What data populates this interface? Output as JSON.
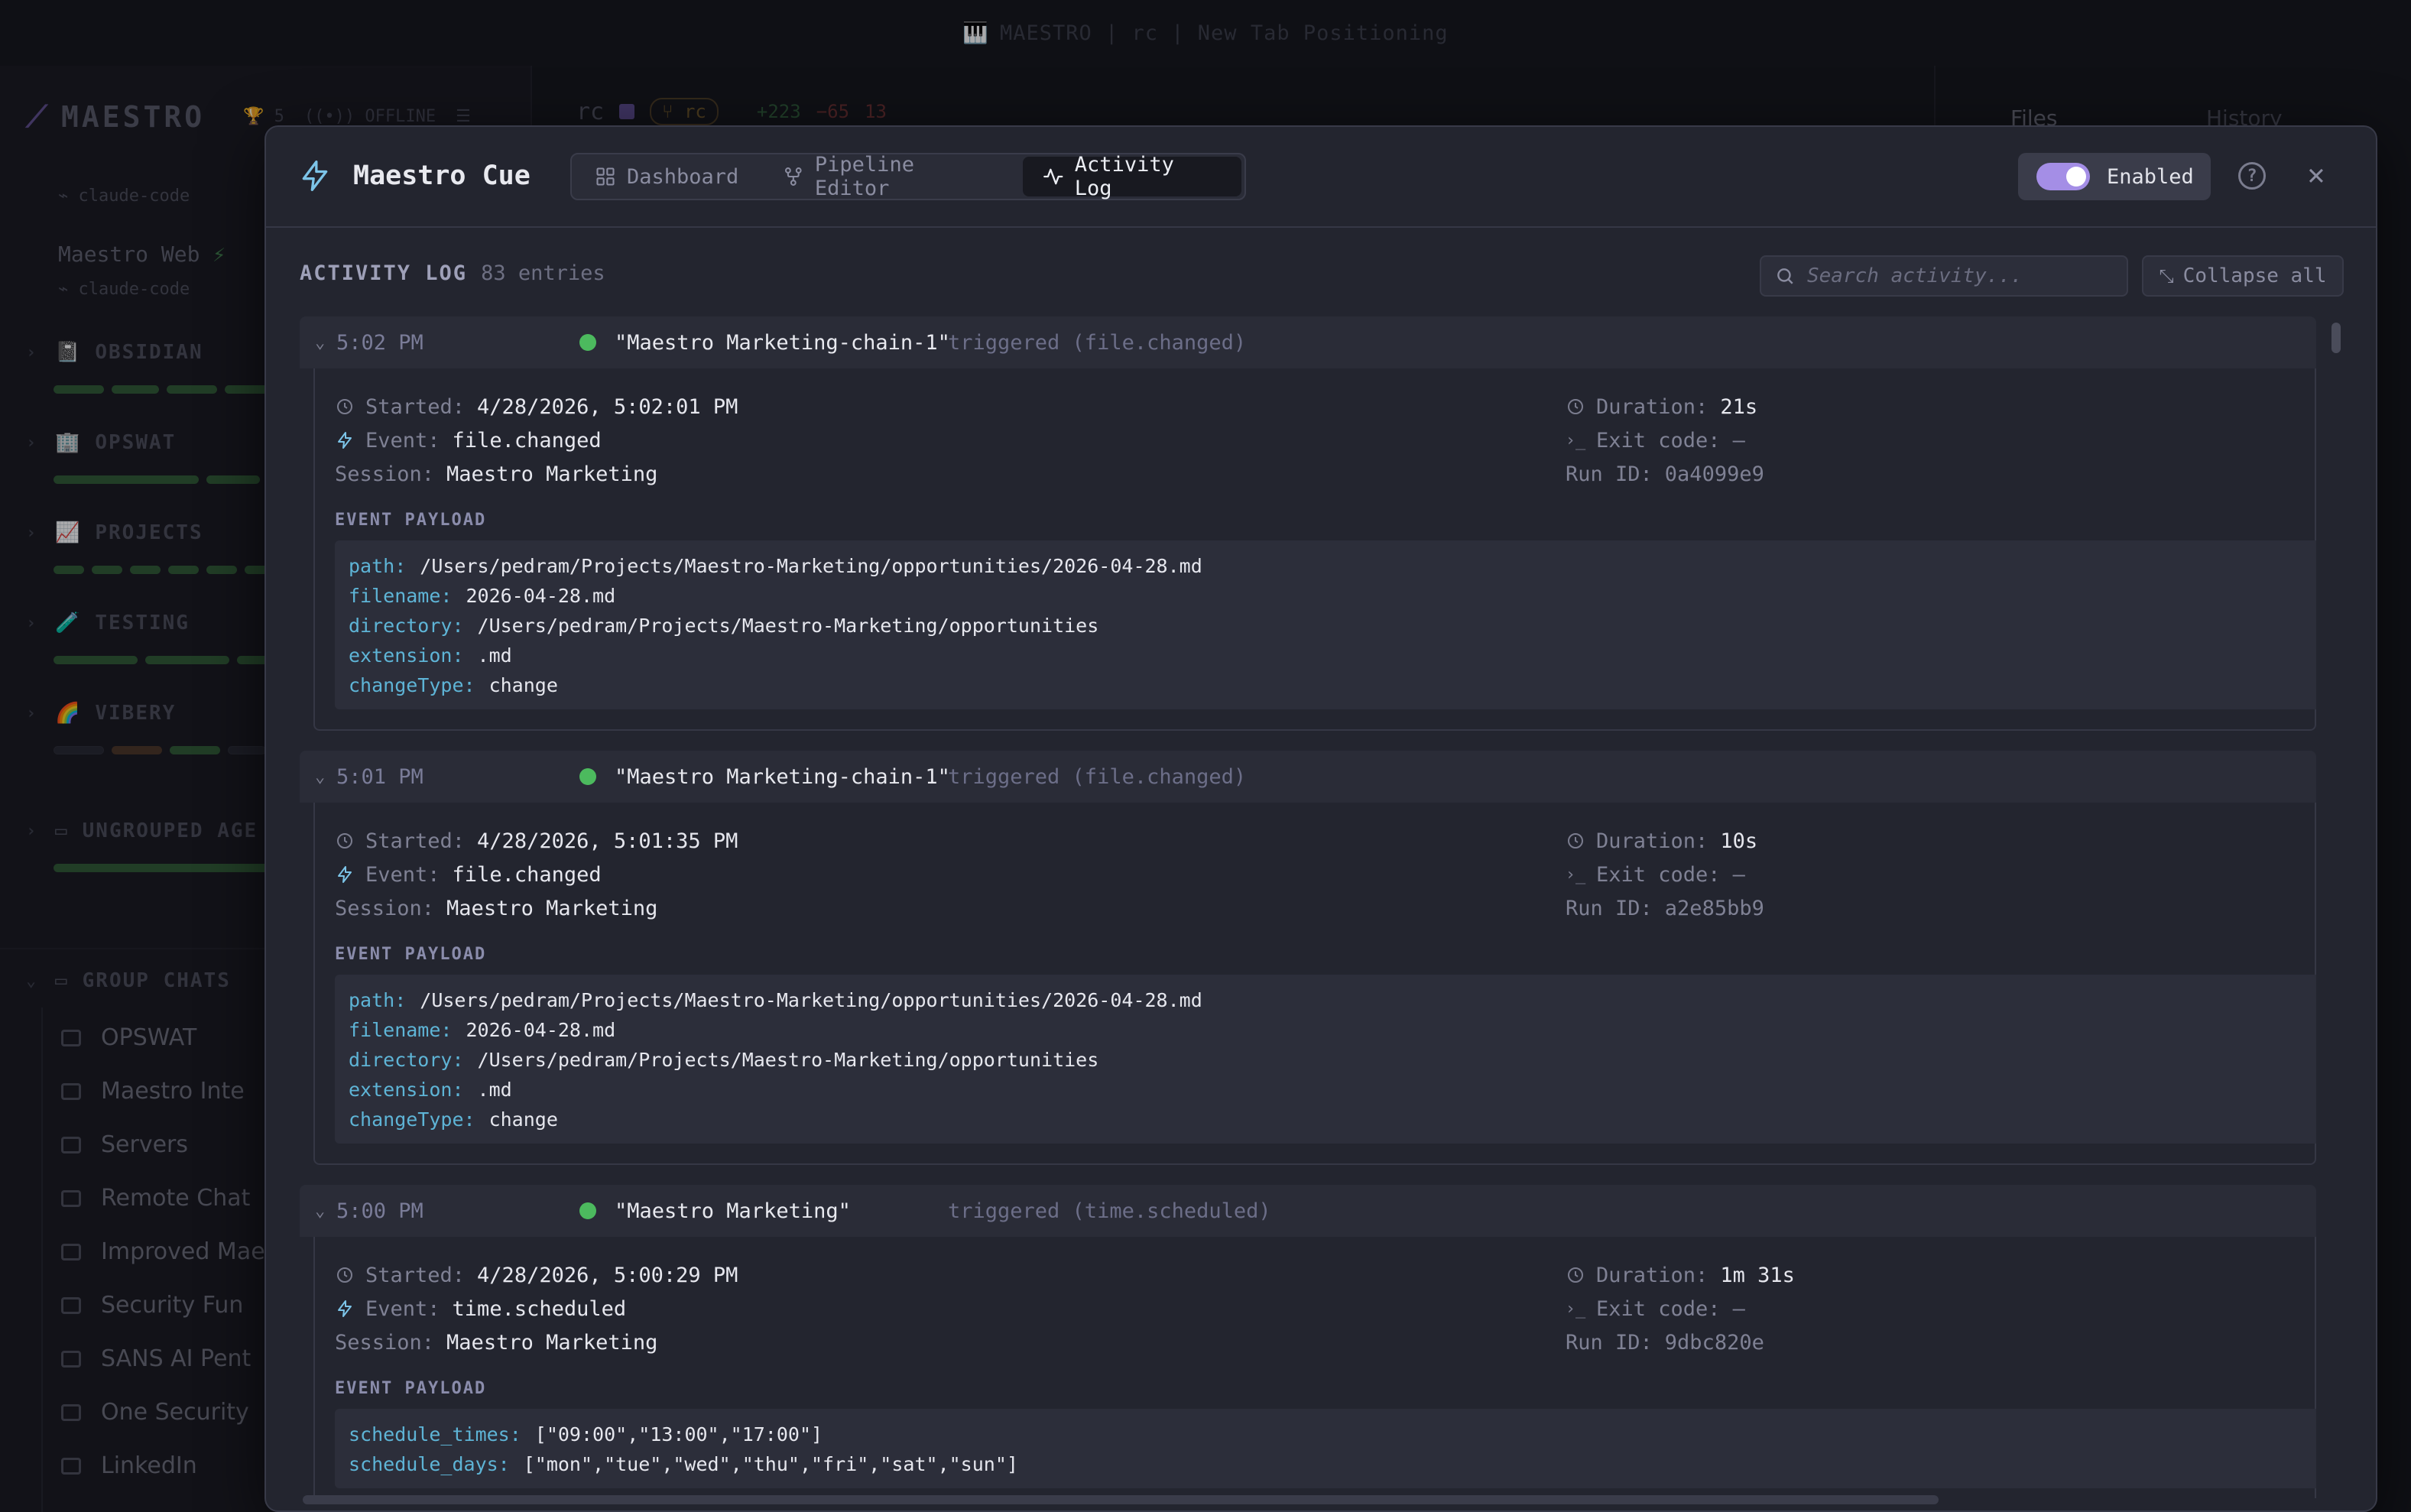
{
  "window": {
    "title": "MAESTRO | rc | New Tab Positioning"
  },
  "sidebar": {
    "brand": "MAESTRO",
    "trophy_count": "5",
    "offline_label": "OFFLINE",
    "agents": [
      {
        "name": "claude-code",
        "sub": "claude-code"
      },
      {
        "name": "Maestro Web",
        "sub": "claude-code"
      }
    ],
    "groups": [
      {
        "label": "OBSIDIAN",
        "emoji": "📓"
      },
      {
        "label": "OPSWAT",
        "emoji": "🏢"
      },
      {
        "label": "PROJECTS",
        "emoji": "📈"
      },
      {
        "label": "TESTING",
        "emoji": "🧪"
      },
      {
        "label": "VIBERY",
        "emoji": "🌈"
      },
      {
        "label": "UNGROUPED AGE"
      }
    ],
    "group_chats_label": "GROUP CHATS",
    "chats": [
      "OPSWAT",
      "Maestro Inte",
      "Servers",
      "Remote Chat",
      "Improved Mae",
      "Security Fun",
      "SANS AI Pent",
      "One Security",
      "LinkedIn"
    ]
  },
  "middle_header": {
    "session": "rc",
    "branch": "rc",
    "additions": "+223",
    "deletions": "−65",
    "files_changed": "13"
  },
  "right_panel": {
    "tabs": [
      "Files",
      "History"
    ]
  },
  "modal": {
    "title": "Maestro Cue",
    "tabs": [
      {
        "label": "Dashboard",
        "icon": "grid-icon"
      },
      {
        "label": "Pipeline Editor",
        "icon": "pipeline-icon"
      },
      {
        "label": "Activity Log",
        "icon": "activity-icon",
        "active": true
      }
    ],
    "toggle_label": "Enabled",
    "toggle_on": true,
    "accent": "#a48ee6"
  },
  "activity": {
    "title": "ACTIVITY LOG",
    "count": "83 entries",
    "search_placeholder": "Search activity...",
    "collapse_label": "Collapse all",
    "payload_label": "EVENT PAYLOAD",
    "labels": {
      "started": "Started:",
      "event": "Event:",
      "session": "Session:",
      "duration": "Duration:",
      "exit_code": "Exit code:",
      "run_id": "Run ID:"
    },
    "entries": [
      {
        "time": "5:02 PM",
        "status_color": "#4cba5e",
        "name": "\"Maestro Marketing-chain-1\"",
        "trigger": "triggered (file.changed)",
        "started": "4/28/2026, 5:02:01 PM",
        "event": "file.changed",
        "session": "Maestro Marketing",
        "duration": "21s",
        "exit_code": "—",
        "run_id": "0a4099e9",
        "payload": [
          {
            "key": "path:",
            "value": "/Users/pedram/Projects/Maestro-Marketing/opportunities/2026-04-28.md"
          },
          {
            "key": "filename:",
            "value": "2026-04-28.md"
          },
          {
            "key": "directory:",
            "value": "/Users/pedram/Projects/Maestro-Marketing/opportunities"
          },
          {
            "key": "extension:",
            "value": ".md"
          },
          {
            "key": "changeType:",
            "value": "change"
          }
        ]
      },
      {
        "time": "5:01 PM",
        "status_color": "#4cba5e",
        "name": "\"Maestro Marketing-chain-1\"",
        "trigger": "triggered (file.changed)",
        "started": "4/28/2026, 5:01:35 PM",
        "event": "file.changed",
        "session": "Maestro Marketing",
        "duration": "10s",
        "exit_code": "—",
        "run_id": "a2e85bb9",
        "payload": [
          {
            "key": "path:",
            "value": "/Users/pedram/Projects/Maestro-Marketing/opportunities/2026-04-28.md"
          },
          {
            "key": "filename:",
            "value": "2026-04-28.md"
          },
          {
            "key": "directory:",
            "value": "/Users/pedram/Projects/Maestro-Marketing/opportunities"
          },
          {
            "key": "extension:",
            "value": ".md"
          },
          {
            "key": "changeType:",
            "value": "change"
          }
        ]
      },
      {
        "time": "5:00 PM",
        "status_color": "#4cba5e",
        "name": "\"Maestro Marketing\"",
        "trigger": "triggered (time.scheduled)",
        "started": "4/28/2026, 5:00:29 PM",
        "event": "time.scheduled",
        "session": "Maestro Marketing",
        "duration": "1m 31s",
        "exit_code": "—",
        "run_id": "9dbc820e",
        "payload": [
          {
            "key": "schedule_times:",
            "value": "[\"09:00\",\"13:00\",\"17:00\"]"
          },
          {
            "key": "schedule_days:",
            "value": "[\"mon\",\"tue\",\"wed\",\"thu\",\"fri\",\"sat\",\"sun\"]"
          }
        ]
      }
    ]
  }
}
